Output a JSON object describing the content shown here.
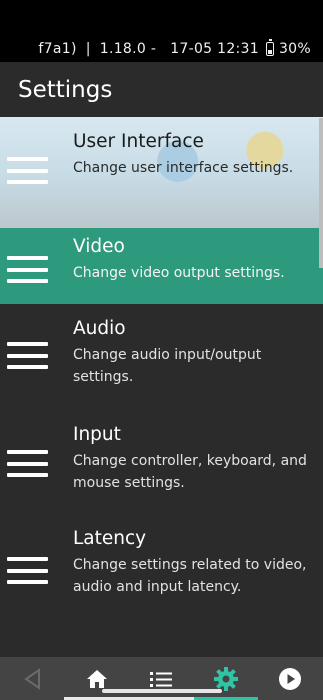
{
  "status_bar": {
    "id": "f7a1)",
    "version": "1.18.0 -",
    "datetime": "17-05 12:31",
    "battery": "30%"
  },
  "header": {
    "title": "Settings"
  },
  "settings_items": [
    {
      "title": "User Interface",
      "desc": "Change user interface settings."
    },
    {
      "title": "Video",
      "desc": "Change video output settings."
    },
    {
      "title": "Audio",
      "desc": "Change audio input/output settings."
    },
    {
      "title": "Input",
      "desc": "Change controller, keyboard, and mouse settings."
    },
    {
      "title": "Latency",
      "desc": "Change settings related to video, audio and input latency."
    }
  ],
  "bottom_nav": {
    "items": [
      "back-icon",
      "home-icon",
      "list-icon",
      "gear-icon",
      "play-icon"
    ],
    "active": "gear-icon",
    "active_color": "#2ec4a4"
  },
  "colors": {
    "selected_item": "#2e9a7d",
    "background": "#2b2b2b"
  }
}
